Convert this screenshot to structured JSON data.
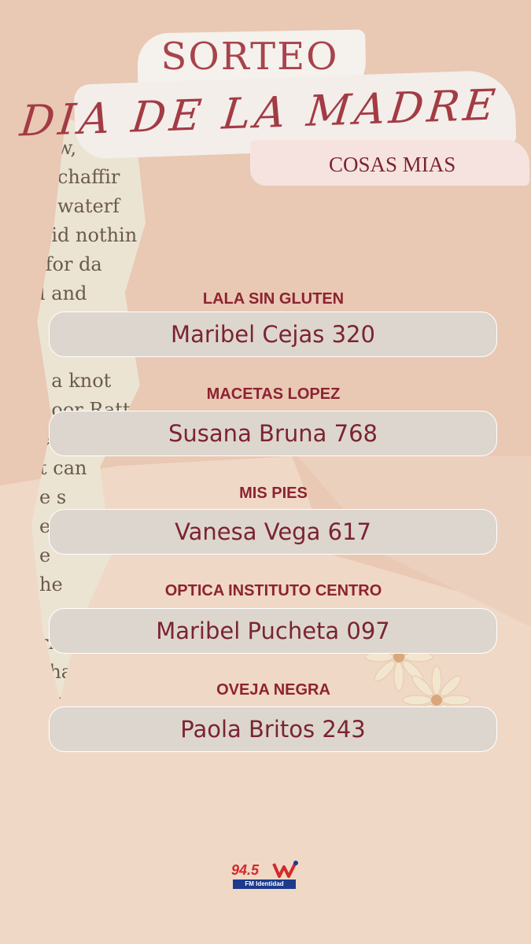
{
  "header": {
    "title": "SORTEO",
    "event": "DIA DE LA MADRE",
    "subtitle": "COSAS MIAS"
  },
  "winners": [
    {
      "store": "LALA SIN GLUTEN",
      "winner": "Maribel Cejas 320"
    },
    {
      "store": "MACETAS LOPEZ",
      "winner": "Susana Bruna 768"
    },
    {
      "store": "MIS PIES",
      "winner": "Vanesa Vega 617"
    },
    {
      "store": "OPTICA INSTITUTO CENTRO",
      "winner": "Maribel Pucheta 097"
    },
    {
      "store": "OVEJA NEGRA",
      "winner": "Paola Britos 243"
    }
  ],
  "decor": {
    "paper_text": "e w,\nd chaffir\nll waterf\ndid nothin\n for da\nl and\n\n\n, a knot\npoor Ratt\ned\nt can\ne s\ned r\ne\nhe\n\nrim\nsha\n w"
  },
  "logo": {
    "frequency": "94.5",
    "station": "FM Identidad"
  },
  "colors": {
    "background": "#e9c8b4",
    "title": "#a8434c",
    "label": "#8c2331",
    "box": "#ddd6cf"
  }
}
